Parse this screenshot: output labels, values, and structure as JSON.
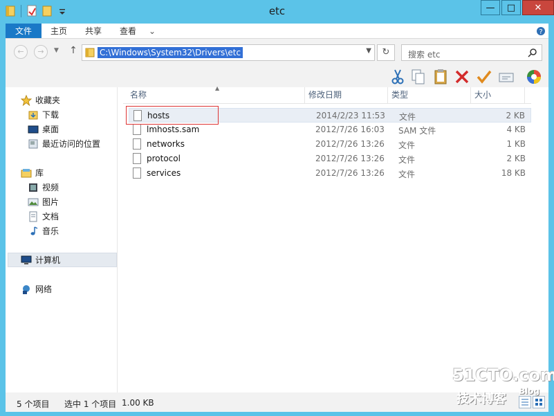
{
  "window": {
    "title": "etc"
  },
  "ribbon": {
    "tabs": [
      {
        "label": "文件"
      },
      {
        "label": "主页"
      },
      {
        "label": "共享"
      },
      {
        "label": "查看"
      }
    ]
  },
  "address": {
    "path": "C:\\Windows\\System32\\Drivers\\etc",
    "search_placeholder": "搜索 etc"
  },
  "nav": {
    "favorites": "收藏夹",
    "downloads": "下载",
    "desktop": "桌面",
    "recent": "最近访问的位置",
    "libraries": "库",
    "videos": "视频",
    "pictures": "图片",
    "documents": "文档",
    "music": "音乐",
    "computer": "计算机",
    "network": "网络"
  },
  "list": {
    "columns": [
      "名称",
      "修改日期",
      "类型",
      "大小"
    ],
    "rows": [
      {
        "name": "hosts",
        "date": "2014/2/23 11:53",
        "type": "文件",
        "size": "2 KB",
        "selected": true
      },
      {
        "name": "lmhosts.sam",
        "date": "2012/7/26 16:03",
        "type": "SAM 文件",
        "size": "4 KB"
      },
      {
        "name": "networks",
        "date": "2012/7/26 13:26",
        "type": "文件",
        "size": "1 KB"
      },
      {
        "name": "protocol",
        "date": "2012/7/26 13:26",
        "type": "文件",
        "size": "2 KB"
      },
      {
        "name": "services",
        "date": "2012/7/26 13:26",
        "type": "文件",
        "size": "18 KB"
      }
    ]
  },
  "status": {
    "items": "5 个项目",
    "selected": "选中 1 个项目",
    "size": "1.00 KB"
  },
  "watermark": {
    "line1": "51CTO.com",
    "line2": "技术博客",
    "line3": "Blog"
  }
}
